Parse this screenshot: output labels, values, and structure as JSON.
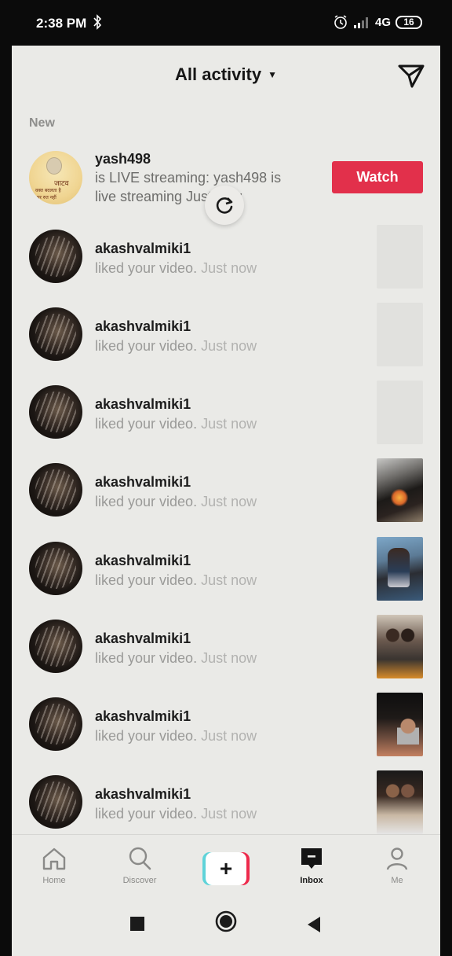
{
  "status_bar": {
    "time": "2:38 PM",
    "network": "4G",
    "battery": "16"
  },
  "header": {
    "title": "All activity",
    "dropdown_icon": "caret-down-icon",
    "send_icon": "direct-message-icon"
  },
  "section_label": "New",
  "live_item": {
    "username": "yash498",
    "message": "is LIVE streaming: yash498 is live streaming Just now",
    "watch_label": "Watch",
    "avatar_text": [
      "जाटव",
      "वक्त बदलता है",
      "पर रुत नहीं"
    ]
  },
  "activity_items": [
    {
      "username": "akashvalmiki1",
      "action": "liked your video.",
      "time": "Just now",
      "thumb": "empty"
    },
    {
      "username": "akashvalmiki1",
      "action": "liked your video.",
      "time": "Just now",
      "thumb": "empty"
    },
    {
      "username": "akashvalmiki1",
      "action": "liked your video.",
      "time": "Just now",
      "thumb": "empty"
    },
    {
      "username": "akashvalmiki1",
      "action": "liked your video.",
      "time": "Just now",
      "thumb": "t1"
    },
    {
      "username": "akashvalmiki1",
      "action": "liked your video.",
      "time": "Just now",
      "thumb": "t2"
    },
    {
      "username": "akashvalmiki1",
      "action": "liked your video.",
      "time": "Just now",
      "thumb": "t3"
    },
    {
      "username": "akashvalmiki1",
      "action": "liked your video.",
      "time": "Just now",
      "thumb": "t4"
    },
    {
      "username": "akashvalmiki1",
      "action": "liked your video.",
      "time": "Just now",
      "thumb": "t5"
    }
  ],
  "bottom_nav": {
    "home": "Home",
    "discover": "Discover",
    "create": "+",
    "inbox": "Inbox",
    "me": "Me",
    "active": "Inbox"
  },
  "colors": {
    "accent": "#e2304b",
    "background": "#eaeae7",
    "create_cyan": "#5fd3d9",
    "create_red": "#ee2a4c"
  }
}
